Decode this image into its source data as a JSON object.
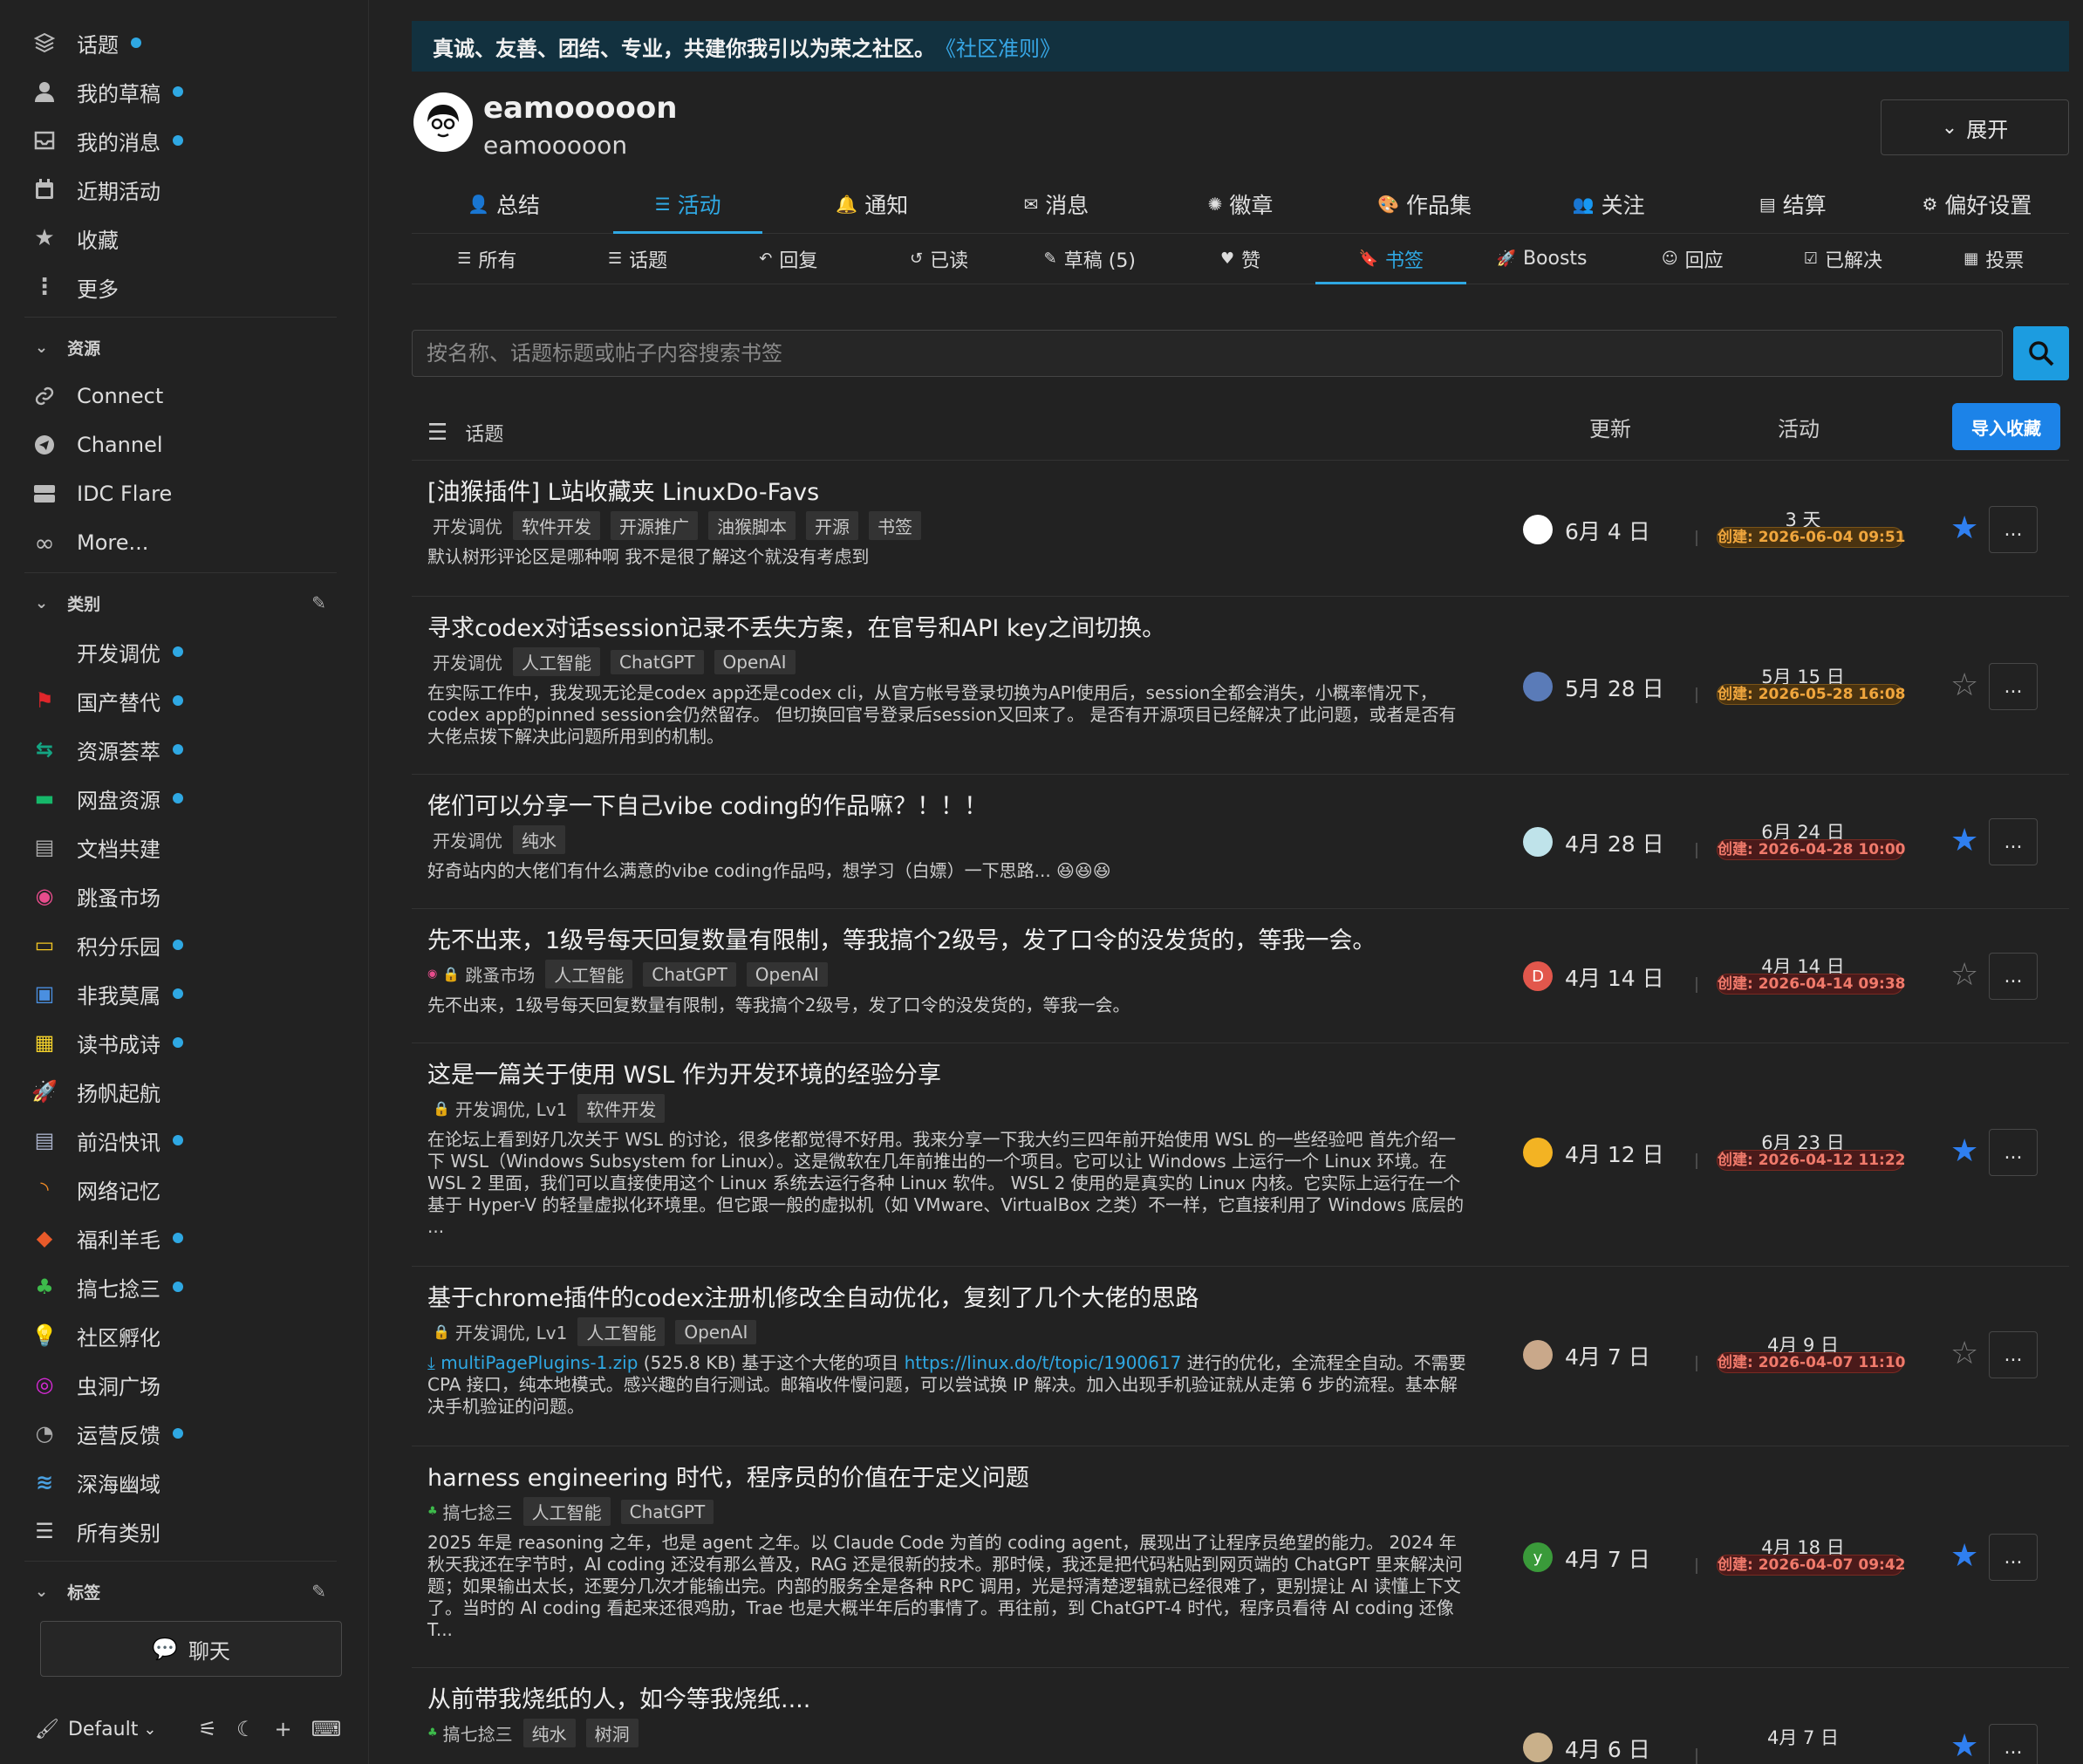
{
  "sidebar": {
    "top_items": [
      {
        "label": "话题",
        "icon": "layers-icon",
        "dot": true
      },
      {
        "label": "我的草稿",
        "icon": "user-icon",
        "dot": true
      },
      {
        "label": "我的消息",
        "icon": "inbox-icon",
        "dot": true
      },
      {
        "label": "近期活动",
        "icon": "calendar-icon",
        "dot": false
      },
      {
        "label": "收藏",
        "icon": "star-icon",
        "dot": false
      },
      {
        "label": "更多",
        "icon": "more-vertical-icon",
        "dot": false
      }
    ],
    "resources_header": "资源",
    "resources": [
      {
        "label": "Connect",
        "icon": "link-icon"
      },
      {
        "label": "Channel",
        "icon": "send-icon"
      },
      {
        "label": "IDC Flare",
        "icon": "server-icon"
      },
      {
        "label": "More...",
        "icon": "infinity-icon"
      }
    ],
    "categories_header": "类别",
    "categories": [
      {
        "label": "开发调优",
        "icon": "code-icon",
        "color": "#32c3c3",
        "dot": true
      },
      {
        "label": "国产替代",
        "icon": "flag-icon",
        "color": "#e0262b",
        "dot": true
      },
      {
        "label": "资源荟萃",
        "icon": "share-icon",
        "color": "#14a583",
        "dot": true
      },
      {
        "label": "网盘资源",
        "icon": "drive-icon",
        "color": "#16b76a",
        "dot": true
      },
      {
        "label": "文档共建",
        "icon": "book-icon",
        "color": "#aaaaaa",
        "dot": false
      },
      {
        "label": "跳蚤市场",
        "icon": "coins-icon",
        "color": "#e84c8c",
        "dot": false
      },
      {
        "label": "积分乐园",
        "icon": "card-icon",
        "color": "#f3c623",
        "dot": true
      },
      {
        "label": "非我莫属",
        "icon": "briefcase-icon",
        "color": "#4a8fe0",
        "dot": true
      },
      {
        "label": "读书成诗",
        "icon": "cubes-icon",
        "color": "#f3d12b",
        "dot": true
      },
      {
        "label": "扬帆起航",
        "icon": "rocket-icon",
        "color": "#f39125",
        "dot": false
      },
      {
        "label": "前沿快讯",
        "icon": "newspaper-icon",
        "color": "#a8b0c8",
        "dot": true
      },
      {
        "label": "网络记忆",
        "icon": "rss-icon",
        "color": "#f08a24",
        "dot": false
      },
      {
        "label": "福利羊毛",
        "icon": "piggy-icon",
        "color": "#e85a2a",
        "dot": true
      },
      {
        "label": "搞七捻三",
        "icon": "leaf-icon",
        "color": "#3dbb4b",
        "dot": true
      },
      {
        "label": "社区孵化",
        "icon": "bulb-icon",
        "color": "#f3c623",
        "dot": false
      },
      {
        "label": "虫洞广场",
        "icon": "swirl-icon",
        "color": "#d62ad6",
        "dot": false
      },
      {
        "label": "运营反馈",
        "icon": "comments-icon",
        "color": "#aaaaaa",
        "dot": true
      },
      {
        "label": "深海幽域",
        "icon": "water-icon",
        "color": "#4aa0e0",
        "dot": false
      },
      {
        "label": "所有类别",
        "icon": "list-icon",
        "color": "#cccccc",
        "dot": false
      }
    ],
    "tags_header": "标签",
    "chat_label": "聊天",
    "theme_label": "Default"
  },
  "banner": {
    "text": "真诚、友善、团结、专业，共建你我引以为荣之社区。",
    "link": "《社区准则》"
  },
  "profile": {
    "name": "eamooooon",
    "handle": "eamooooon",
    "expand_label": "展开"
  },
  "tabs_primary": [
    {
      "label": "总结",
      "icon": "user-icon"
    },
    {
      "label": "活动",
      "icon": "list-icon",
      "active": true
    },
    {
      "label": "通知",
      "icon": "bell-icon"
    },
    {
      "label": "消息",
      "icon": "envelope-icon"
    },
    {
      "label": "徽章",
      "icon": "badge-icon"
    },
    {
      "label": "作品集",
      "icon": "palette-icon"
    },
    {
      "label": "关注",
      "icon": "users-icon"
    },
    {
      "label": "结算",
      "icon": "billing-icon"
    },
    {
      "label": "偏好设置",
      "icon": "gear-icon"
    }
  ],
  "tabs_secondary": [
    {
      "label": "所有",
      "icon": "bars-icon"
    },
    {
      "label": "话题",
      "icon": "list-icon"
    },
    {
      "label": "回复",
      "icon": "reply-icon"
    },
    {
      "label": "已读",
      "icon": "history-icon"
    },
    {
      "label": "草稿 (5)",
      "icon": "pencil-icon"
    },
    {
      "label": "赞",
      "icon": "heart-icon"
    },
    {
      "label": "书签",
      "icon": "bookmark-icon",
      "active": true
    },
    {
      "label": "Boosts",
      "icon": "rocket-icon"
    },
    {
      "label": "回应",
      "icon": "smile-icon"
    },
    {
      "label": "已解决",
      "icon": "check-square-icon"
    },
    {
      "label": "投票",
      "icon": "poll-icon"
    }
  ],
  "search": {
    "placeholder": "按名称、话题标题或帖子内容搜索书签"
  },
  "list_header": {
    "topic": "话题",
    "updated": "更新",
    "activity": "活动",
    "import_label": "导入收藏"
  },
  "topics": [
    {
      "title": "[油猴插件] L站收藏夹 LinuxDo-Favs",
      "category": "开发调优",
      "cat_color": "#32c3c3",
      "tags": [
        "软件开发",
        "开源推广",
        "油猴脚本",
        "开源",
        "书签"
      ],
      "excerpt": "默认树形评论区是哪种啊 我不是很了解这个就没有考虑到",
      "updated": "6月 4 日",
      "avatar": "",
      "avatar_color": "#ffffff",
      "activity": "3 天",
      "created": "创建: 2026-06-04 09:51",
      "badge": "orange",
      "starred": true
    },
    {
      "title": "寻求codex对话session记录不丢失方案，在官号和API key之间切换。",
      "category": "开发调优",
      "cat_color": "#32c3c3",
      "tags": [
        "人工智能",
        "ChatGPT",
        "OpenAI"
      ],
      "excerpt": "在实际工作中，我发现无论是codex app还是codex cli，从官方帐号登录切换为API使用后，session全都会消失，小概率情况下，codex app的pinned session会仍然留存。 但切换回官号登录后session又回来了。 是否有开源项目已经解决了此问题，或者是否有大佬点拨下解决此问题所用到的机制。",
      "updated": "5月 28 日",
      "avatar": "",
      "avatar_color": "#5a7bb8",
      "activity": "5月 15 日",
      "created": "创建: 2026-05-28 16:08",
      "badge": "orange",
      "starred": false
    },
    {
      "title": "佬们可以分享一下自己vibe coding的作品嘛？！！！",
      "category": "开发调优",
      "cat_color": "#32c3c3",
      "tags": [
        "纯水"
      ],
      "excerpt": "好奇站内的大佬们有什么满意的vibe coding作品吗，想学习（白嫖）一下思路... 😆😆😆",
      "updated": "4月 28 日",
      "avatar": "",
      "avatar_color": "#bfe3ea",
      "activity": "6月 24 日",
      "created": "创建: 2026-04-28 10:00",
      "badge": "red",
      "starred": true
    },
    {
      "title": "先不出来，1级号每天回复数量有限制，等我搞个2级号，发了口令的没发货的，等我一会。",
      "category": "跳蚤市场",
      "cat_color": "#e84c8c",
      "tags": [
        "人工智能",
        "ChatGPT",
        "OpenAI"
      ],
      "excerpt": "先不出来，1级号每天回复数量有限制，等我搞个2级号，发了口令的没发货的，等我一会。",
      "updated": "4月 14 日",
      "avatar": "D",
      "avatar_color": "#e2574c",
      "activity": "4月 14 日",
      "created": "创建: 2026-04-14 09:38",
      "badge": "red",
      "starred": false
    },
    {
      "title": "这是一篇关于使用 WSL 作为开发环境的经验分享",
      "category": "开发调优, Lv1",
      "cat_color": "#32c3c3",
      "tags": [
        "软件开发"
      ],
      "excerpt": "在论坛上看到好几次关于 WSL 的讨论，很多佬都觉得不好用。我来分享一下我大约三四年前开始使用 WSL 的一些经验吧 首先介绍一下 WSL（Windows Subsystem for Linux）。这是微软在几年前推出的一个项目。它可以让 Windows 上运行一个 Linux 环境。在 WSL 2 里面，我们可以直接使用这个 Linux 系统去运行各种 Linux 软件。 WSL 2 使用的是真实的 Linux 内核。它实际上运行在一个基于 Hyper-V 的轻量虚拟化环境里。但它跟一般的虚拟机（如 VMware、VirtualBox 之类）不一样，它直接利用了 Windows 底层的 ...",
      "updated": "4月 12 日",
      "avatar": "",
      "avatar_color": "#f3b323",
      "activity": "6月 23 日",
      "created": "创建: 2026-04-12 11:22",
      "badge": "red",
      "starred": true
    },
    {
      "title": "基于chrome插件的codex注册机修改全自动优化，复刻了几个大佬的思路",
      "category": "开发调优, Lv1",
      "cat_color": "#32c3c3",
      "tags": [
        "人工智能",
        "OpenAI"
      ],
      "attachment": "multiPagePlugins-1.zip",
      "attachment_size": "(525.8 KB)",
      "excerpt_pre": "基于这个大佬的项目",
      "link": "https://linux.do/t/topic/1900617",
      "excerpt": "进行的优化，全流程全自动。不需要 CPA 接口，纯本地模式。感兴趣的自行测试。邮箱收件慢问题，可以尝试换 IP 解决。加入出现手机验证就从走第 6 步的流程。基本解决手机验证的问题。",
      "updated": "4月 7 日",
      "avatar": "",
      "avatar_color": "#c9a88a",
      "activity": "4月 9 日",
      "created": "创建: 2026-04-07 11:10",
      "badge": "red",
      "starred": false
    },
    {
      "title": "harness engineering 时代，程序员的价值在于定义问题",
      "category": "搞七捻三",
      "cat_color": "#3dbb4b",
      "tags": [
        "人工智能",
        "ChatGPT"
      ],
      "excerpt": "2025 年是 reasoning 之年，也是 agent 之年。以 Claude Code 为首的 coding agent，展现出了让程序员绝望的能力。 2024 年秋天我还在字节时，AI coding 还没有那么普及，RAG 还是很新的技术。那时候，我还是把代码粘贴到网页端的 ChatGPT 里来解决问题；如果输出太长，还要分几次才能输出完。内部的服务全是各种 RPC 调用，光是捋清楚逻辑就已经很难了，更别提让 AI 读懂上下文了。当时的 AI coding 看起来还很鸡肋，Trae 也是大概半年后的事情了。再往前，到 ChatGPT-4 时代，程序员看待 AI coding 还像 T...",
      "updated": "4月 7 日",
      "avatar": "y",
      "avatar_color": "#3a9a3a",
      "activity": "4月 18 日",
      "created": "创建: 2026-04-07 09:42",
      "badge": "red",
      "starred": true
    },
    {
      "title": "从前带我烧纸的人，如今等我烧纸....",
      "category": "搞七捻三",
      "cat_color": "#3dbb4b",
      "tags": [
        "纯水",
        "树洞"
      ],
      "excerpt": "",
      "updated": "4月 6 日",
      "avatar": "",
      "avatar_color": "#c9b08a",
      "activity": "4月 7 日",
      "created": "",
      "badge": "red",
      "starred": true
    }
  ]
}
